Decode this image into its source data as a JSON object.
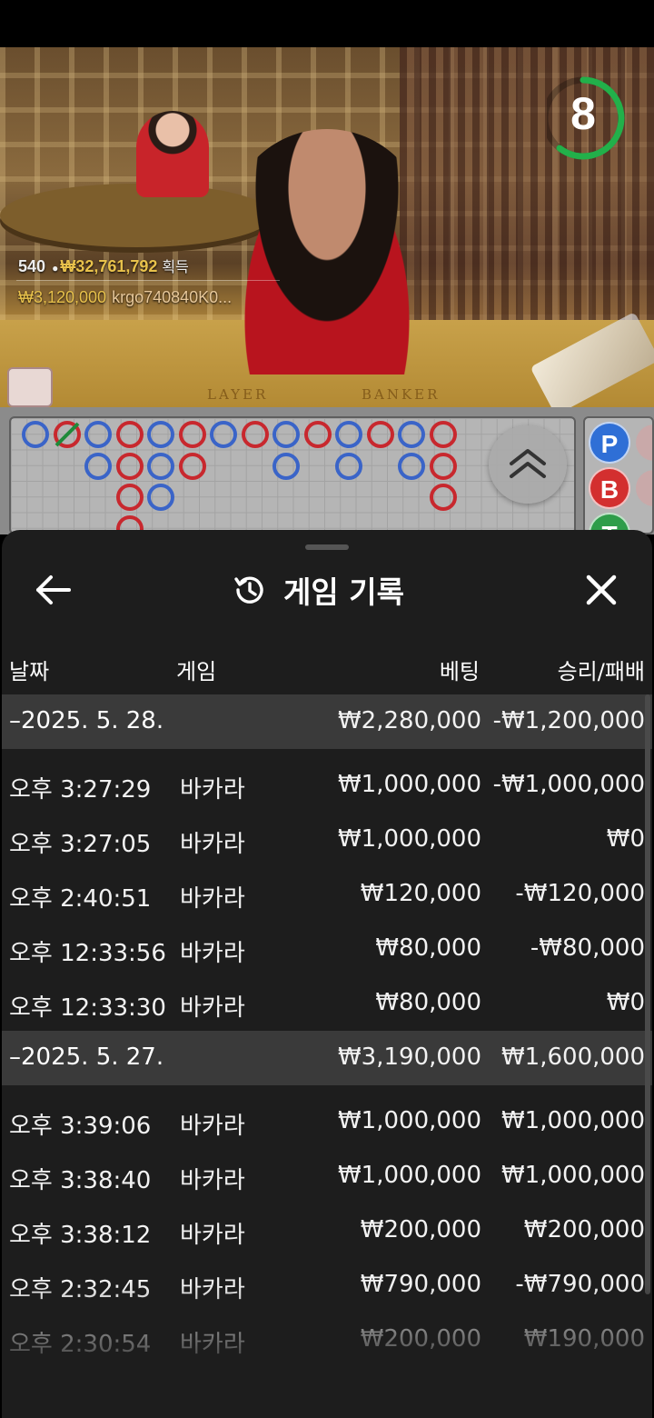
{
  "live": {
    "timer": "8",
    "winner_summary": {
      "count": "540",
      "amount": "₩32,761,792",
      "suffix": "획득"
    },
    "latest_win": {
      "amount": "₩3,120,000",
      "user": "krgo740840K0..."
    },
    "table_labels": {
      "player": "LAYER",
      "banker": "BANKER"
    }
  },
  "roadmap": {
    "side_buttons": [
      {
        "label": "P",
        "color": "#2f6fd6"
      },
      {
        "label": "B",
        "color": "#d32f2f"
      },
      {
        "label": "T",
        "color": "#2e9d4a"
      }
    ],
    "colors": {
      "player": "#3a64c8",
      "banker": "#c8282e",
      "tie": "#1f8a3a"
    }
  },
  "history": {
    "title": "게임 기록",
    "icons": {
      "back": "arrow-left-icon",
      "title": "history-icon",
      "close": "close-icon"
    },
    "columns": {
      "date": "날짜",
      "game": "게임",
      "bet": "베팅",
      "result": "승리/패배"
    },
    "groups": [
      {
        "date": "–2025. 5. 28.",
        "bet_total": "₩2,280,000",
        "result_total": "-₩1,200,000",
        "rows": [
          {
            "time": "오후 3:27:29",
            "game": "바카라",
            "bet": "₩1,000,000",
            "result": "-₩1,000,000"
          },
          {
            "time": "오후 3:27:05",
            "game": "바카라",
            "bet": "₩1,000,000",
            "result": "₩0"
          },
          {
            "time": "오후 2:40:51",
            "game": "바카라",
            "bet": "₩120,000",
            "result": "-₩120,000"
          },
          {
            "time": "오후 12:33:56",
            "game": "바카라",
            "bet": "₩80,000",
            "result": "-₩80,000"
          },
          {
            "time": "오후 12:33:30",
            "game": "바카라",
            "bet": "₩80,000",
            "result": "₩0"
          }
        ]
      },
      {
        "date": "–2025. 5. 27.",
        "bet_total": "₩3,190,000",
        "result_total": "₩1,600,000",
        "rows": [
          {
            "time": "오후 3:39:06",
            "game": "바카라",
            "bet": "₩1,000,000",
            "result": "₩1,000,000"
          },
          {
            "time": "오후 3:38:40",
            "game": "바카라",
            "bet": "₩1,000,000",
            "result": "₩1,000,000"
          },
          {
            "time": "오후 3:38:12",
            "game": "바카라",
            "bet": "₩200,000",
            "result": "₩200,000"
          },
          {
            "time": "오후 2:32:45",
            "game": "바카라",
            "bet": "₩790,000",
            "result": "-₩790,000"
          },
          {
            "time": "오후 2:30:54",
            "game": "바카라",
            "bet": "₩200,000",
            "result": "₩190,000"
          }
        ]
      }
    ]
  }
}
